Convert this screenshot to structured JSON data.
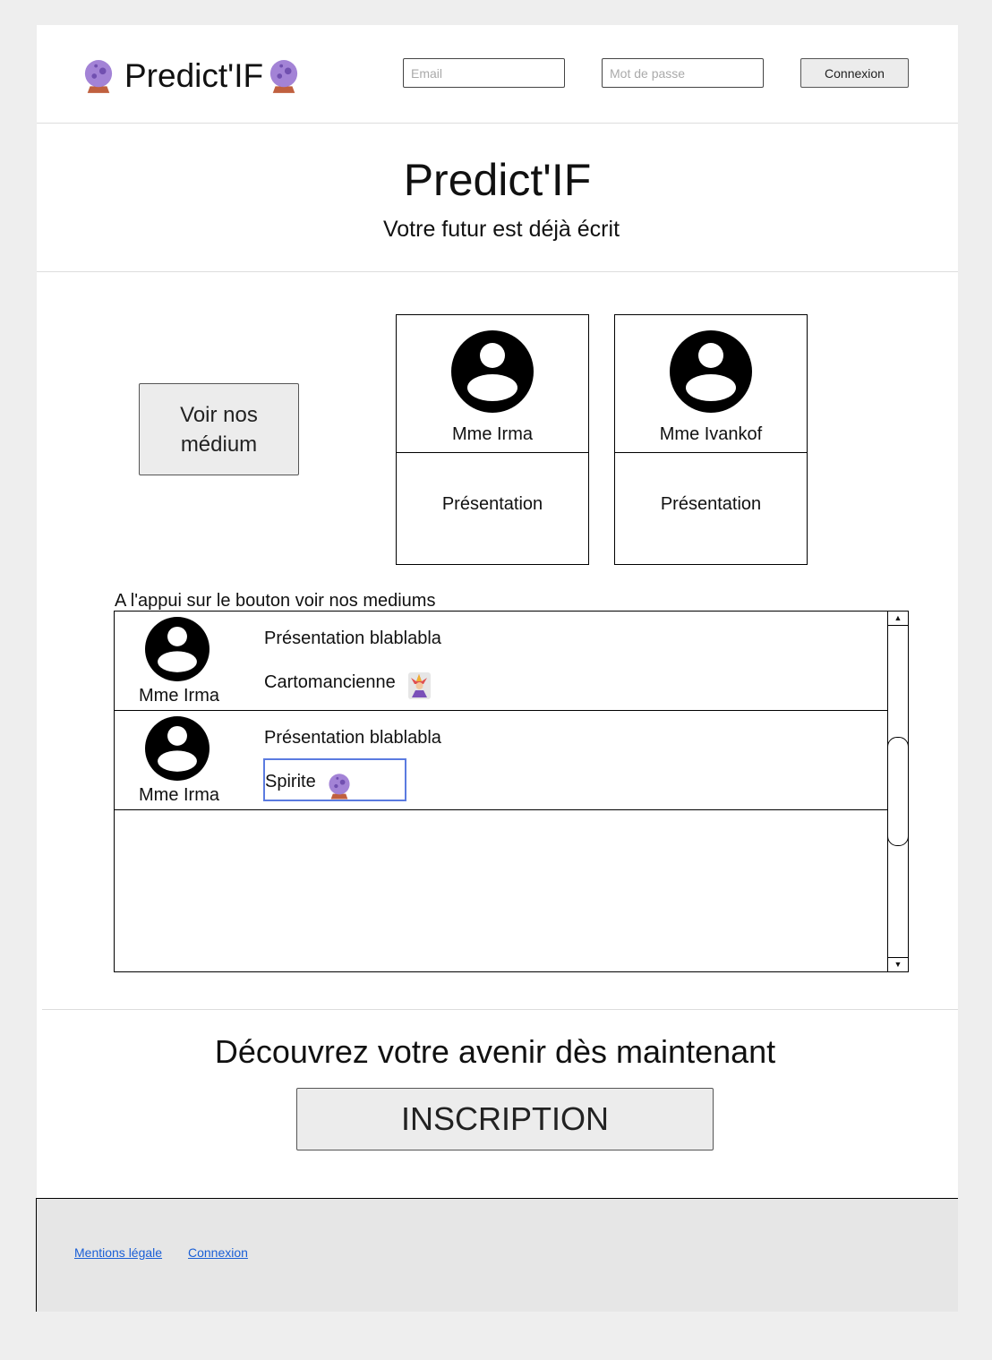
{
  "header": {
    "brand": "Predict'IF",
    "email_placeholder": "Email",
    "password_placeholder": "Mot de passe",
    "login_label": "Connexion"
  },
  "hero": {
    "title": "Predict'IF",
    "subtitle": "Votre futur est déjà écrit"
  },
  "mediums_button": "Voir nos médium",
  "cards": [
    {
      "name": "Mme Irma",
      "presentation": "Présentation"
    },
    {
      "name": "Mme Ivankof",
      "presentation": "Présentation"
    }
  ],
  "list_caption": "A l'appui sur le bouton voir nos mediums",
  "list": [
    {
      "name": "Mme Irma",
      "presentation": "Présentation blablabla",
      "type": "Cartomancienne",
      "icon": "joker-card-icon"
    },
    {
      "name": "Mme Irma",
      "presentation": "Présentation blablabla",
      "type": "Spirite",
      "icon": "crystal-ball-icon"
    }
  ],
  "cta": {
    "title": "Découvrez votre avenir dès maintenant",
    "button": "INSCRIPTION"
  },
  "footer": {
    "links": [
      "Mentions légale",
      "Connexion"
    ]
  },
  "colors": {
    "accent": "#5b7be0",
    "ball": "#a383d6",
    "link": "#1a5fd6"
  }
}
